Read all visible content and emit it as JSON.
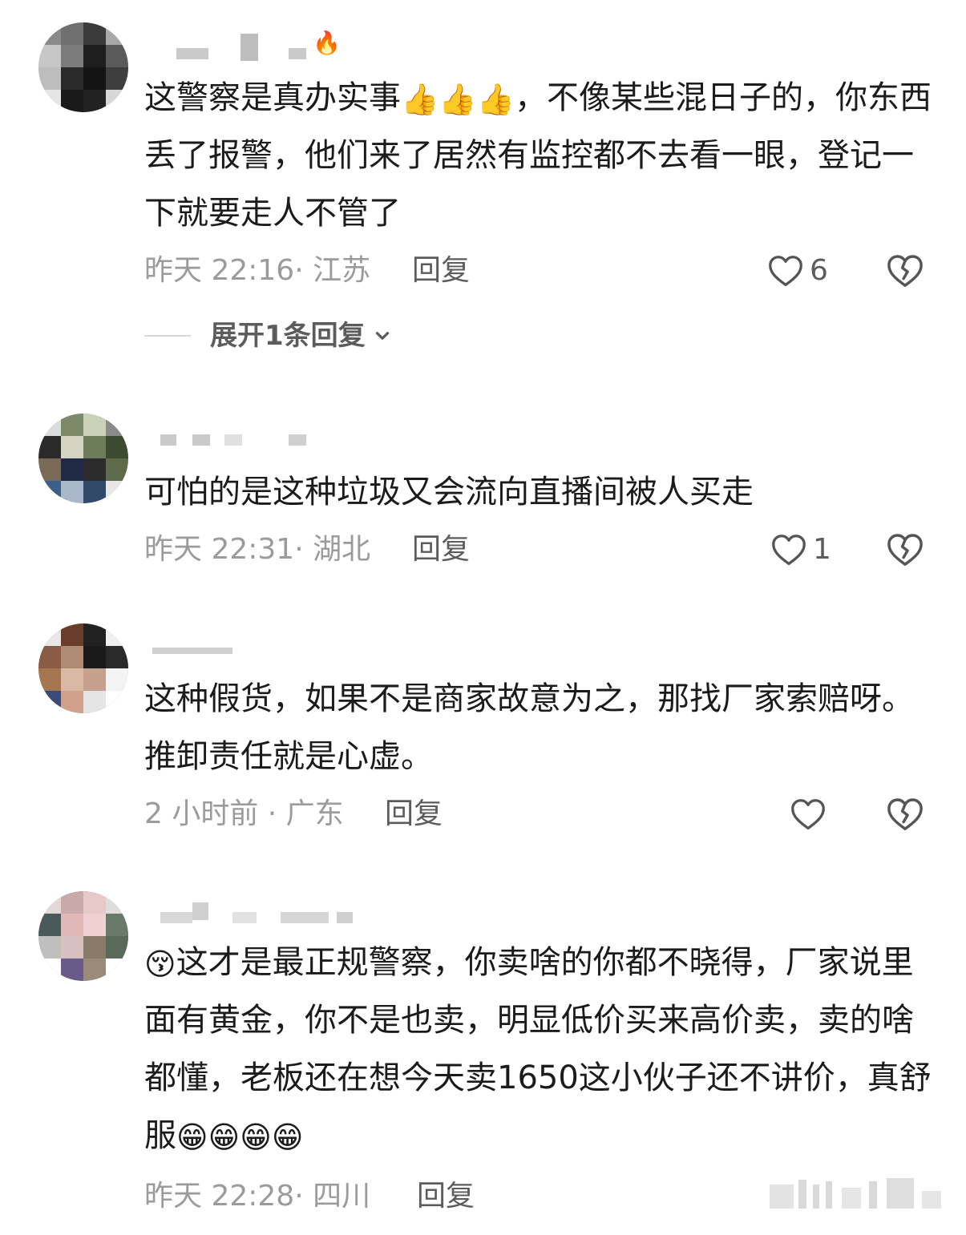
{
  "actions": {
    "reply_label": "回复"
  },
  "comments": [
    {
      "text": "这警察是真办实事",
      "emoji": "👍",
      "text_after": "，不像某些混日子的，你东西丢了报警，他们来了居然有监控都不去看一眼，登记一下就要走人不管了",
      "time_location": "昨天 22:16· 江苏",
      "likes": "6",
      "expand_label": "展开1条回复"
    },
    {
      "text": "可怕的是这种垃圾又会流向直播间被人买走",
      "time_location": "昨天 22:31· 湖北",
      "likes": "1"
    },
    {
      "text": "这种假货，如果不是商家故意为之，那找厂家索赔呀。推卸责任就是心虚。",
      "time_location": "2 小时前 · 广东",
      "likes": ""
    },
    {
      "emoji_before": "😚",
      "text": "这才是最正规警察，你卖啥的你都不晓得，厂家说里面有黄金，你不是也卖，明显低价买来高价卖，卖的啥都懂，老板还在想今天卖1650这小伙子还不讲价，真舒服",
      "emoji": "😁",
      "time_location": "昨天 22:28· 四川"
    }
  ],
  "icons": {
    "like": "heart-outline-icon",
    "dislike": "broken-heart-icon",
    "expand": "chevron-down-icon",
    "name_badge": "flame-icon"
  },
  "colors": {
    "text_primary": "#1b1b1b",
    "text_meta": "#9b9b9b",
    "text_action": "#5c5c5c",
    "icon": "#555555"
  }
}
